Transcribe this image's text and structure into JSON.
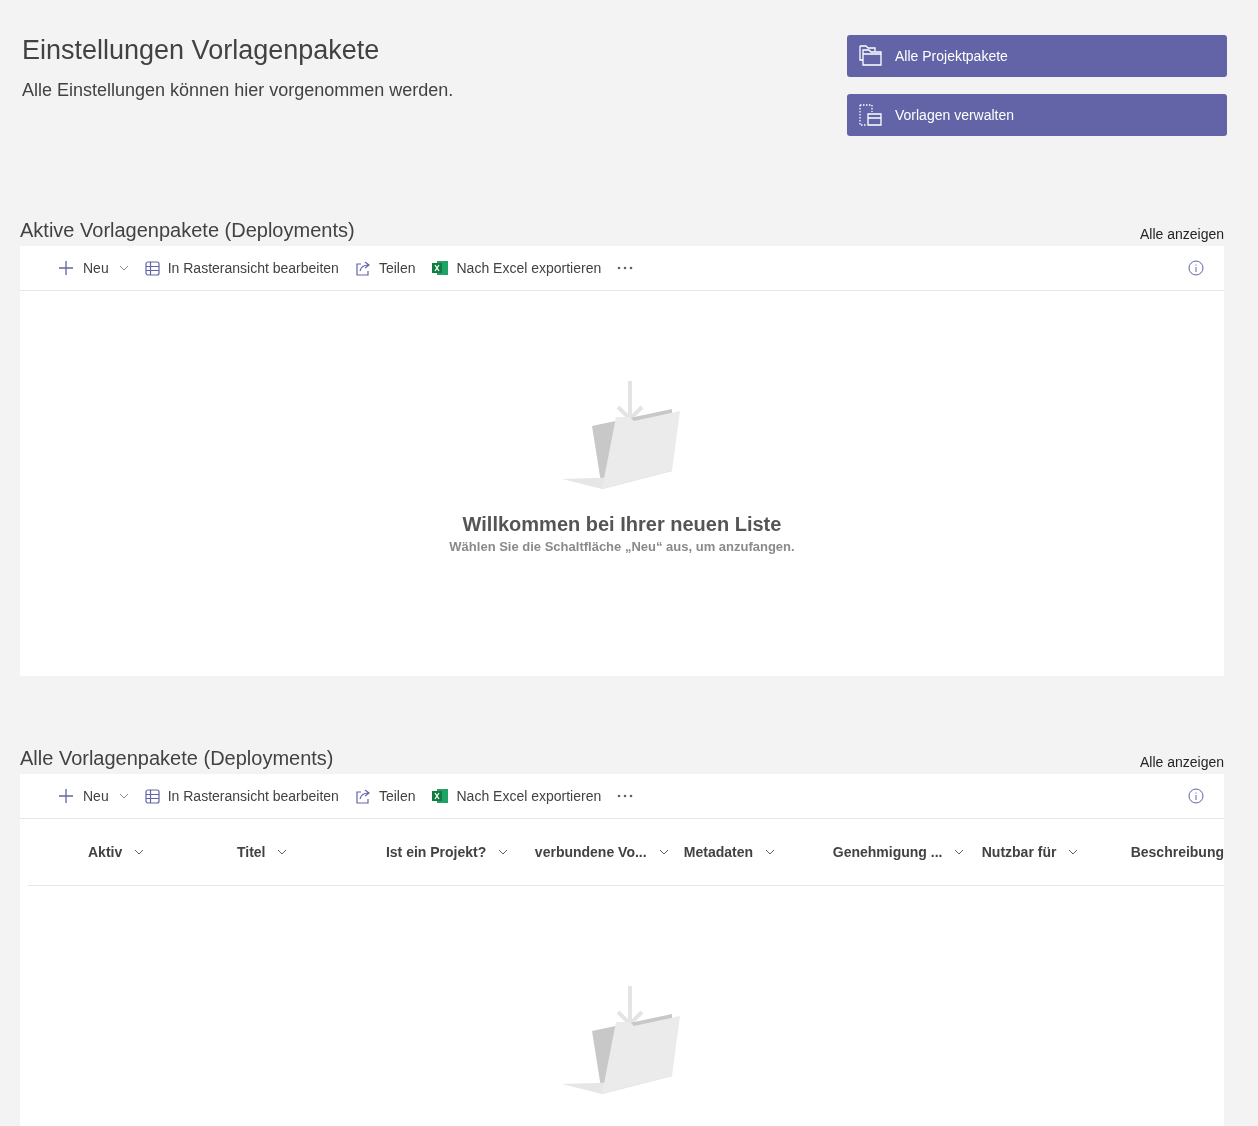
{
  "header": {
    "title": "Einstellungen Vorlagenpakete",
    "subtitle": "Alle Einstellungen können hier vorgenommen werden."
  },
  "actions": [
    {
      "kind": "folders",
      "label": "Alle Projektpakete"
    },
    {
      "kind": "templates",
      "label": "Vorlagen verwalten"
    }
  ],
  "lists": [
    {
      "title": "Aktive Vorlagenpakete (Deployments)",
      "link": "Alle anzeigen",
      "toolbar": [
        {
          "kind": "new",
          "label": "Neu"
        },
        {
          "kind": "grid",
          "label": "In Rasteransicht bearbeiten"
        },
        {
          "kind": "share",
          "label": "Teilen"
        },
        {
          "kind": "excel",
          "label": "Nach Excel exportieren"
        },
        {
          "kind": "more"
        }
      ],
      "empty": {
        "title": "Willkommen bei Ihrer neuen Liste",
        "hint": "Wählen Sie die Schaltfläche „Neu“ aus, um anzufangen."
      }
    },
    {
      "title": "Alle Vorlagenpakete (Deployments)",
      "link": "Alle anzeigen",
      "toolbar": [
        {
          "kind": "new",
          "label": "Neu"
        },
        {
          "kind": "grid",
          "label": "In Rasteransicht bearbeiten"
        },
        {
          "kind": "share",
          "label": "Teilen"
        },
        {
          "kind": "excel",
          "label": "Nach Excel exportieren"
        },
        {
          "kind": "more"
        }
      ],
      "columns": [
        {
          "label": "Aktiv",
          "menu": true
        },
        {
          "label": "Titel",
          "menu": true
        },
        {
          "label": "Ist ein Projekt?",
          "menu": true
        },
        {
          "label": "verbundene Vo...",
          "menu": true
        },
        {
          "label": "Metadaten",
          "menu": true
        },
        {
          "label": "Genehmigung ...",
          "menu": true
        },
        {
          "label": "Nutzbar für",
          "menu": true
        },
        {
          "label": "Beschreibung",
          "menu": false
        }
      ]
    }
  ]
}
